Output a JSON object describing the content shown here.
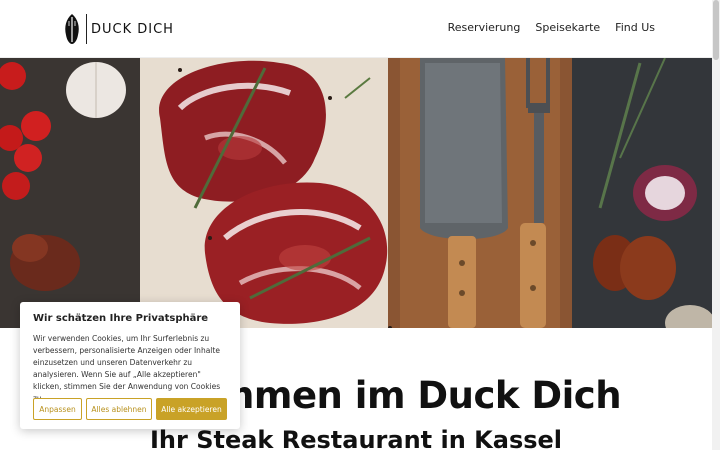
{
  "header": {
    "logo_text": "DUCK DICH",
    "nav": [
      "Reservierung",
      "Speisekarte",
      "Find Us"
    ]
  },
  "hero": {
    "image": "steak-hero-image",
    "contents": [
      "raw ribeye steaks",
      "rosemary",
      "cleaver knife",
      "meat fork",
      "cherry tomatoes",
      "garlic",
      "red onion",
      "thyme",
      "wooden cutting board"
    ]
  },
  "main": {
    "headline": "Willkommen im Duck Dich",
    "subheadline": "Ihr Steak Restaurant in Kassel"
  },
  "cookie_banner": {
    "title": "Wir schätzen Ihre Privatsphäre",
    "text": "Wir verwenden Cookies, um Ihr Surferlebnis zu verbessern, personalisierte Anzeigen oder Inhalte einzusetzen und unseren Datenverkehr zu analysieren. Wenn Sie auf „Alle akzeptieren\" klicken, stimmen Sie der Anwendung von Cookies zu.",
    "btn_customize": "Anpassen",
    "btn_reject": "Alles ablehnen",
    "btn_accept": "Alle akzeptieren"
  },
  "colors": {
    "accent": "#c9a227",
    "text": "#111111",
    "background": "#ffffff"
  }
}
